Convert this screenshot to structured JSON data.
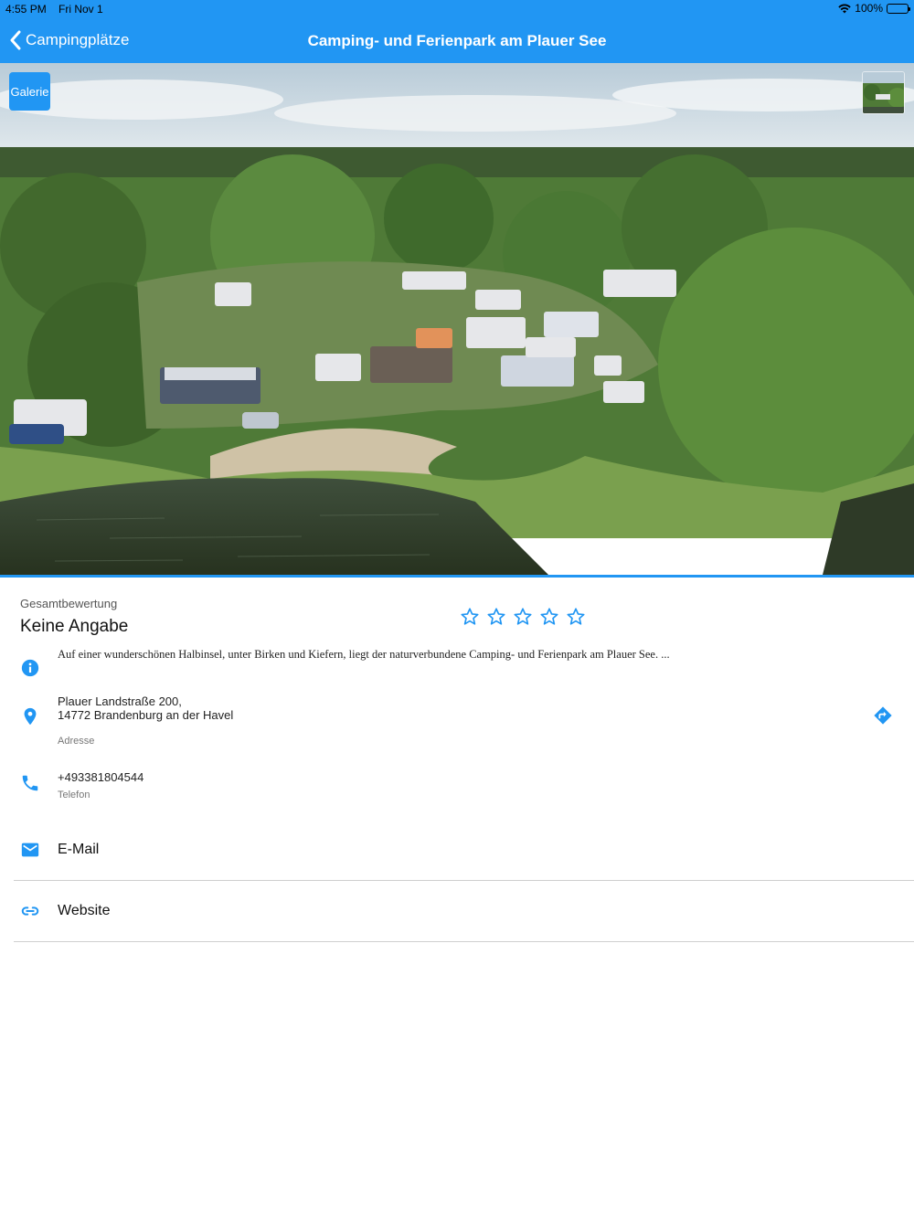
{
  "status_bar": {
    "time": "4:55 PM",
    "date": "Fri Nov 1",
    "battery": "100%",
    "battery_level": 1.0
  },
  "nav": {
    "back_label": "Campingplätze",
    "title": "Camping- und Ferienpark am Plauer See"
  },
  "hero": {
    "gallery_label": "Galerie"
  },
  "rating": {
    "label": "Gesamtbewertung",
    "value": "Keine Angabe",
    "stars_filled": 0,
    "stars_total": 5
  },
  "description": "Auf einer wunderschönen Halbinsel, unter Birken und Kiefern, liegt der naturverbundene Camping- und Ferienpark am Plauer See. ...",
  "address": {
    "line1": "Plauer Landstraße 200,",
    "line2": "14772 Brandenburg an der Havel",
    "label": "Adresse"
  },
  "phone": {
    "number": "+493381804544",
    "label": "Telefon"
  },
  "links": {
    "email": "E-Mail",
    "website": "Website"
  },
  "colors": {
    "accent": "#2196f3"
  }
}
